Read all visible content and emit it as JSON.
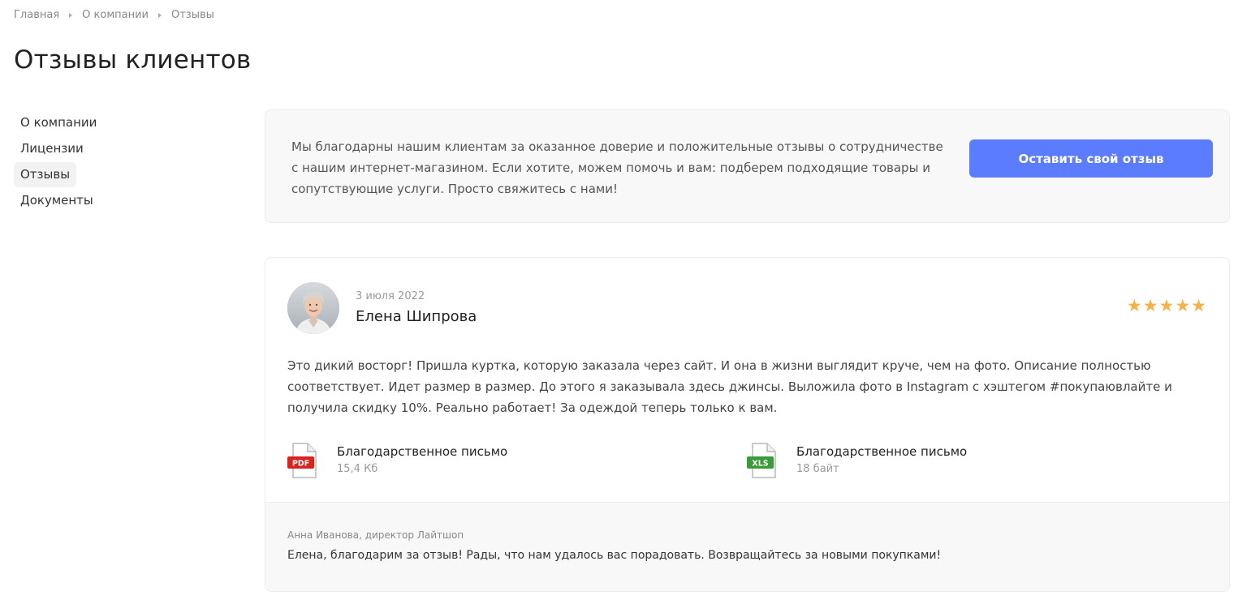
{
  "breadcrumb": {
    "items": [
      "Главная",
      "О компании",
      "Отзывы"
    ]
  },
  "page": {
    "title": "Отзывы клиентов"
  },
  "sidebar": {
    "items": [
      {
        "label": "О компании",
        "active": false
      },
      {
        "label": "Лицензии",
        "active": false
      },
      {
        "label": "Отзывы",
        "active": true
      },
      {
        "label": "Документы",
        "active": false
      }
    ]
  },
  "intro": {
    "text": "Мы благодарны нашим клиентам за оказанное доверие и положительные отзывы о сотрудничестве с нашим интернет-магазином. Если хотите, можем помочь и вам: подберем подходящие товары и сопутствующие услуги. Просто свяжитесь с нами!",
    "button_label": "Оставить свой отзыв"
  },
  "review": {
    "date": "3 июля 2022",
    "author": "Елена Шипрова",
    "rating": 5,
    "rating_max": 5,
    "text": "Это дикий восторг! Пришла куртка, которую заказала через сайт. И она в жизни выглядит круче, чем на фото. Описание полностью соответствует. Идет размер в размер. До этого я заказывала здесь джинсы. Выложила фото в Instagram с хэштегом #покупаювлайте и получила скидку 10%. Реально работает! За одеждой теперь только к вам.",
    "documents": [
      {
        "type": "PDF",
        "title": "Благодарственное письмо",
        "size": "15,4 Кб",
        "badge_color": "#d9231f"
      },
      {
        "type": "XLS",
        "title": "Благодарственное письмо",
        "size": "18 байт",
        "badge_color": "#3d9a3a"
      }
    ],
    "reply": {
      "author": "Анна Иванова, директор Лайтшоп",
      "text": "Елена, благодарим за отзыв! Рады, что нам удалось вас порадовать. Возвращайтесь за новыми покупками!"
    }
  },
  "colors": {
    "accent": "#5b7cff",
    "star": "#f6b24a",
    "panel": "#f8f8f8"
  }
}
